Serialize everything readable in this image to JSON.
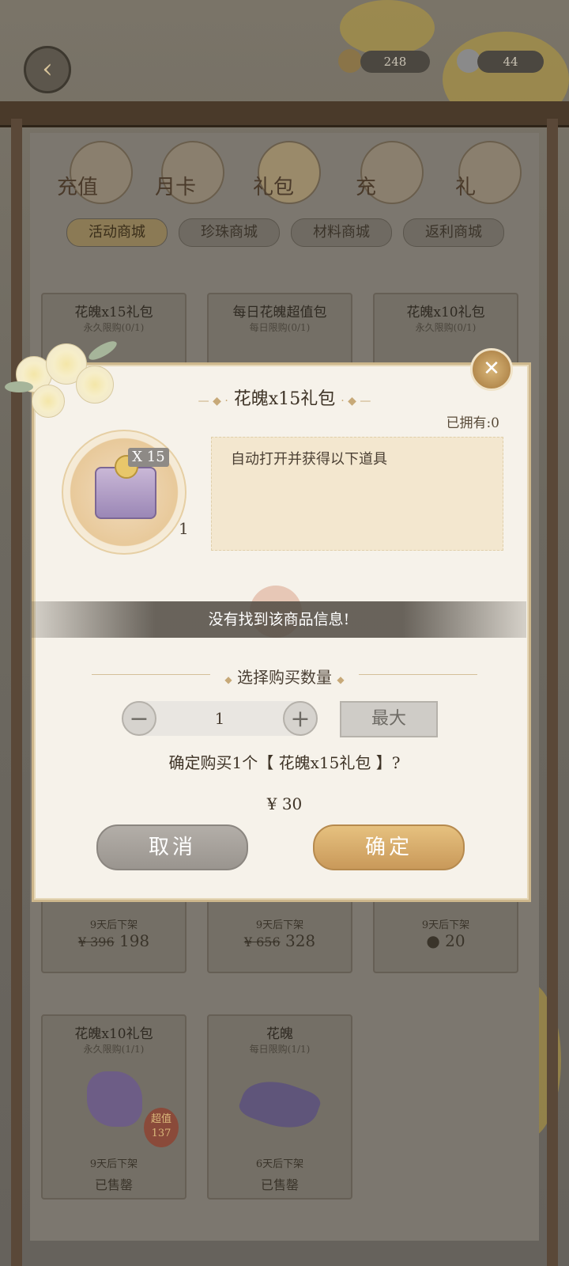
{
  "header": {
    "currency1": "248",
    "currency2": "44"
  },
  "tabs": [
    {
      "label": "充值",
      "icon": "coin-icon"
    },
    {
      "label": "月卡",
      "icon": "card-icon"
    },
    {
      "label": "礼包",
      "icon": "gift-bag-icon"
    },
    {
      "label": "充",
      "icon": "gift-box-icon"
    },
    {
      "label": "礼",
      "icon": "shop-icon"
    }
  ],
  "subtabs": [
    "活动商城",
    "珍珠商城",
    "材料商城",
    "返利商城"
  ],
  "cards_row1": [
    {
      "title": "花魄x15礼包",
      "limit": "永久限购(0/1)",
      "foot": "9天后下架",
      "old_price": "¥ 396",
      "price": "198"
    },
    {
      "title": "每日花魄超值包",
      "limit": "每日限购(0/1)",
      "foot": "9天后下架",
      "old_price": "¥ 656",
      "price": "328"
    },
    {
      "title": "花魄x10礼包",
      "limit": "永久限购(0/1)",
      "foot": "9天后下架",
      "old_price": "",
      "price": "20"
    }
  ],
  "cards_row2": [
    {
      "title": "花魄x10礼包",
      "limit": "永久限购(1/1)",
      "badge": "超值",
      "badge_num": "137",
      "foot": "9天后下架",
      "status": "已售罄"
    },
    {
      "title": "花魄",
      "limit": "每日限购(1/1)",
      "foot": "6天后下架",
      "status": "已售罄"
    }
  ],
  "dialog": {
    "title": "花魄x15礼包",
    "owned": "已拥有:0",
    "item_qty_badge": "X 15",
    "item_count": "1",
    "description": "自动打开并获得以下道具",
    "toast": "没有找到该商品信息!",
    "select_label": "选择购买数量",
    "minus": "−",
    "plus": "+",
    "quantity": "1",
    "max_label": "最大",
    "confirm_text": "确定购买1个【 花魄x15礼包 】?",
    "price": "¥ 30",
    "cancel_label": "取消",
    "ok_label": "确定"
  },
  "colors": {
    "accent_gold": "#c9995a",
    "dialog_bg": "#f6f2ea",
    "frame_brown": "#4a3a2a"
  }
}
